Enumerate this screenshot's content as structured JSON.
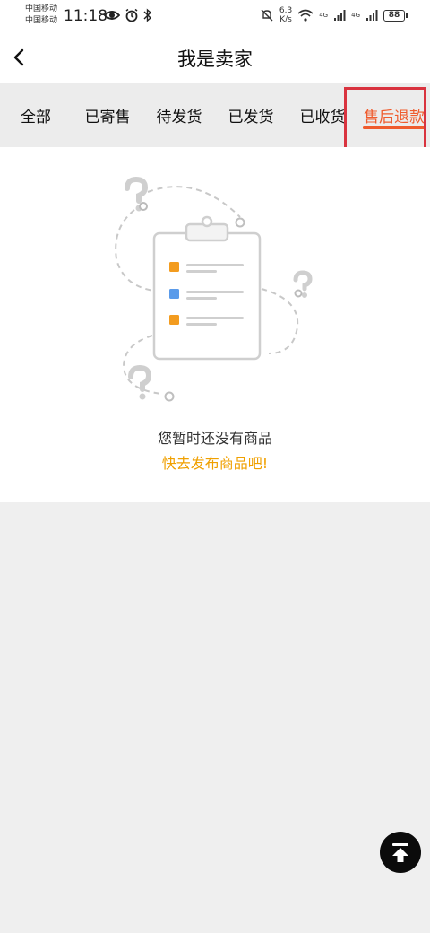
{
  "status_bar": {
    "carrier_1": "中国移动",
    "carrier_2": "中国移动",
    "time": "11:18",
    "net_speed_value": "6.3",
    "net_speed_unit": "K/s",
    "signal_1_label": "4G",
    "signal_2_label": "4G",
    "battery": "88",
    "icons": [
      "eye-icon",
      "alarm-icon",
      "bluetooth-icon",
      "mute-icon",
      "wifi-icon",
      "signal-icon",
      "battery-icon"
    ]
  },
  "header": {
    "title": "我是卖家",
    "back_icon": "chevron-left-icon"
  },
  "tabs": [
    {
      "label": "全部"
    },
    {
      "label": "已寄售"
    },
    {
      "label": "待发货"
    },
    {
      "label": "已发货"
    },
    {
      "label": "已收货"
    },
    {
      "label": "售后退款",
      "active": true
    }
  ],
  "empty_state": {
    "message": "您暂时还没有商品",
    "action_link": "快去发布商品吧!"
  },
  "colors": {
    "accent": "#ef5b2d",
    "link": "#f0a000",
    "highlight_border": "#d9333f",
    "tab_bar_bg": "#ececec",
    "page_bg": "#efefef"
  },
  "fab": {
    "icon": "scroll-to-top-icon"
  }
}
